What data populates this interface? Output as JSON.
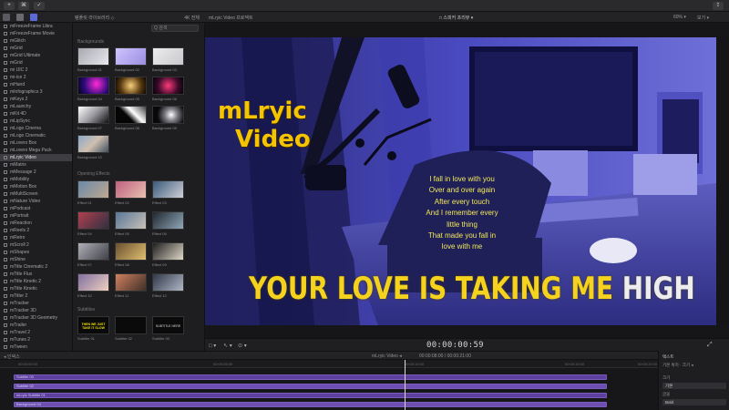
{
  "toolbar": {
    "buttons": [
      {
        "icon": "plus-icon",
        "glyph": "+"
      },
      {
        "icon": "key-icon",
        "glyph": "⌘"
      },
      {
        "icon": "check-icon",
        "glyph": "✓"
      },
      {
        "icon": "share-icon",
        "glyph": "⇪"
      }
    ]
  },
  "library": {
    "title": "템플릿 라이브러리 ◇",
    "resolution": "4K 전체"
  },
  "viewer_header": {
    "project": "mLryic Video 프로젝트",
    "view_label": "□ 스피커 프리뷰 ▾",
    "zoom": "60% ▾",
    "view_menu": "보기 ▾"
  },
  "projects": [
    "mFreezeFrame Libra",
    "mFreezeFrame Movie",
    "mGlitch",
    "mGrid",
    "mGrid Ultimate",
    "mGrid",
    "mi UIC 2",
    "mi-ice 2",
    "mHand",
    "mInfographics 3",
    "mKeys 2",
    "mLaunchy",
    "mKit 4D",
    "mLipSync",
    "mLogo Cinema",
    "mLogo Cinematic",
    "mLovers Box",
    "mLovers Mega Pack",
    "mLryic Video",
    "mMatrix",
    "mMessage 2",
    "mMobility",
    "mMotion Box",
    "mMultiScreen",
    "mNature Video",
    "mPodcast",
    "mPortrait",
    "mReaction",
    "mReels 2",
    "mRetro",
    "mScroll 2",
    "mShapes",
    "mShine",
    "mTitle Cinematic 2",
    "mTitle Flux",
    "mTitle Kinetic 2",
    "mTitle Kinetic",
    "mTitler 2",
    "mTracker",
    "mTracker 3D",
    "mTracker 3D Geometry",
    "mTrailer",
    "mTravel 2",
    "mTunes 2",
    "mTween",
    "mVortex",
    "mWedge"
  ],
  "selected_project": "mLryic Video",
  "browser": {
    "search_placeholder": "Q 검색",
    "sections": [
      "Backgrounds",
      "Opening Effects",
      "Subtitles"
    ],
    "backgrounds": [
      {
        "caption": "Background 01",
        "fill": "linear-gradient(135deg,#a9a9b1,#e8e8ee)"
      },
      {
        "caption": "Background 02",
        "fill": "linear-gradient(135deg,#cfc3ff,#9a8fe0)"
      },
      {
        "caption": "Background 03",
        "fill": "linear-gradient(135deg,#ededee,#c8c8cd)"
      },
      {
        "caption": "Background 04",
        "fill": "radial-gradient(circle at 60% 40%,#ff2ad4,#2a0a7a 60%,#050514)"
      },
      {
        "caption": "Background 05",
        "fill": "radial-gradient(circle at 50% 50%,#f6d07a,#5a3a10 60%,#0a0604)"
      },
      {
        "caption": "Background 06",
        "fill": "radial-gradient(circle at 50% 50%,#ff3a7a,#3a0a2a 60%,#050305)"
      },
      {
        "caption": "Background 07",
        "fill": "linear-gradient(135deg,#ffffff,#9a9aa0 50%,#101012)"
      },
      {
        "caption": "Background 08",
        "fill": "linear-gradient(45deg,#050505 40%,#ffffff 60%,#404044)"
      },
      {
        "caption": "Background 09",
        "fill": "radial-gradient(circle at 60% 50%,#ffffff,#808088 30%,#08080a 70%)"
      },
      {
        "caption": "Background 10",
        "fill": "linear-gradient(135deg,#8aa8c8,#d0c0b0 50%,#405060)"
      }
    ],
    "opening": [
      {
        "caption": "Effect 01",
        "fill": "linear-gradient(135deg,#6a8aa8,#c0a890)"
      },
      {
        "caption": "Effect 02",
        "fill": "linear-gradient(135deg,#c06080,#e8c0b0)"
      },
      {
        "caption": "Effect 03",
        "fill": "linear-gradient(135deg,#3a5a7a,#d0d0d8)"
      },
      {
        "caption": "Effect 04",
        "fill": "linear-gradient(135deg,#b04050,#303040)"
      },
      {
        "caption": "Effect 05",
        "fill": "linear-gradient(135deg,#5a7898,#c8c0b8)"
      },
      {
        "caption": "Effect 06",
        "fill": "linear-gradient(135deg,#202830,#90a8b8)"
      },
      {
        "caption": "Effect 07",
        "fill": "linear-gradient(135deg,#b0b0b8,#404048)"
      },
      {
        "caption": "Effect 08",
        "fill": "linear-gradient(135deg,#6a5030,#e0c070)"
      },
      {
        "caption": "Effect 09",
        "fill": "linear-gradient(135deg,#202020,#e0d8c8)"
      },
      {
        "caption": "Effect 10",
        "fill": "linear-gradient(135deg,#8070a0,#f0d0c0)"
      },
      {
        "caption": "Effect 11",
        "fill": "linear-gradient(135deg,#d08060,#403028)"
      },
      {
        "caption": "Effect 12",
        "fill": "linear-gradient(135deg,#303848,#b0b8c8)"
      }
    ],
    "subtitles": [
      {
        "caption": "Subtitle 01",
        "text": "THEN WE JUST TAKE IT SLOW",
        "style": "yellow"
      },
      {
        "caption": "Subtitle 02",
        "text": "",
        "style": "dark"
      },
      {
        "caption": "Subtitle 03",
        "text": "SUBTITLE HERE",
        "style": "white"
      }
    ]
  },
  "viewer": {
    "title_line1": "mLryic",
    "title_line2": "Video",
    "lyrics": [
      "I fall in love with you",
      "Over and over again",
      "After every touch",
      "And I remember every",
      "little thing",
      "That made you fall in",
      "love with me"
    ],
    "big_line_main": "YOUR LOVE IS TAKING ME ",
    "big_line_end": "HIGH",
    "timecode": "00:00:00:59",
    "tools": [
      "□ ▾",
      "↖ ▾",
      "⊙ ▾"
    ]
  },
  "timeline": {
    "header_left": "◂ 인덱스",
    "header_center": "mLryic Video ◂",
    "header_right": "00:00:08:00 / 00:00:21:00",
    "ruler_ticks": [
      "00:00:00:00",
      "00:00:05:00",
      "00:00:10:00",
      "00:00:15:00",
      "00:00:20:00"
    ],
    "clips": [
      {
        "label": "Subtitle 03"
      },
      {
        "label": "Subtitle 02"
      },
      {
        "label": "mLryic Subtitle 01"
      },
      {
        "label": "Background 04"
      }
    ]
  },
  "inspector": {
    "title": "텍스트",
    "subtitle": "기본 위치 · 크기 ◂",
    "row_a": "크기",
    "field_a": "기본",
    "row_b": "글꼴",
    "field_b": "Bold"
  }
}
